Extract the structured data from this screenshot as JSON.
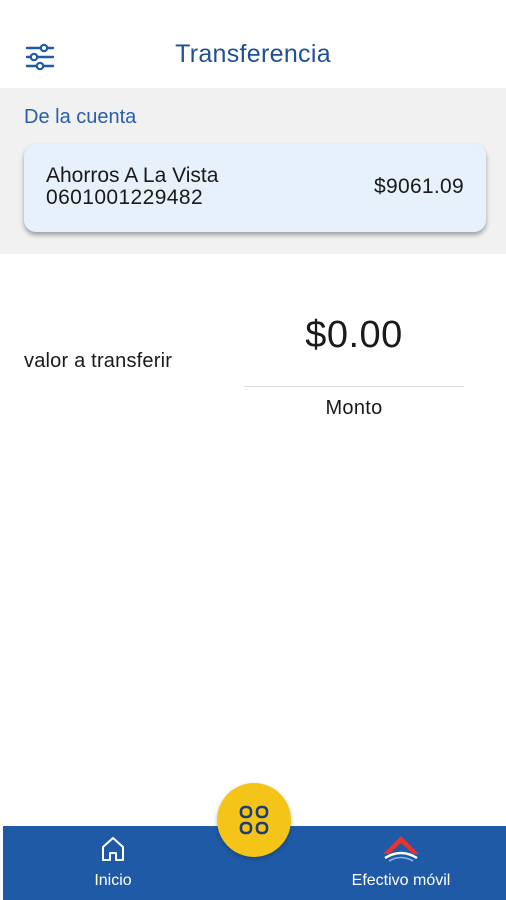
{
  "header": {
    "title": "Transferencia",
    "menu_icon": "sliders-icon"
  },
  "from_account": {
    "label": "De la cuenta",
    "name": "Ahorros A La Vista",
    "number": "0601001229482",
    "balance": "$9061.09"
  },
  "transfer": {
    "label": "valor a transferir",
    "amount": "$0.00",
    "amount_caption": "Monto"
  },
  "bottom_nav": {
    "items": [
      {
        "label": "Inicio",
        "icon": "home-icon"
      },
      {
        "label": "Efectivo móvil",
        "icon": "cash-mobile-icon"
      }
    ],
    "center_button_icon": "apps-grid-icon"
  },
  "colors": {
    "brand_blue": "#1f5aa6",
    "title_blue": "#1f4f95",
    "accent_yellow": "#f4c418",
    "card_background": "#e6f1fb",
    "section_background": "#f1f1f1"
  }
}
